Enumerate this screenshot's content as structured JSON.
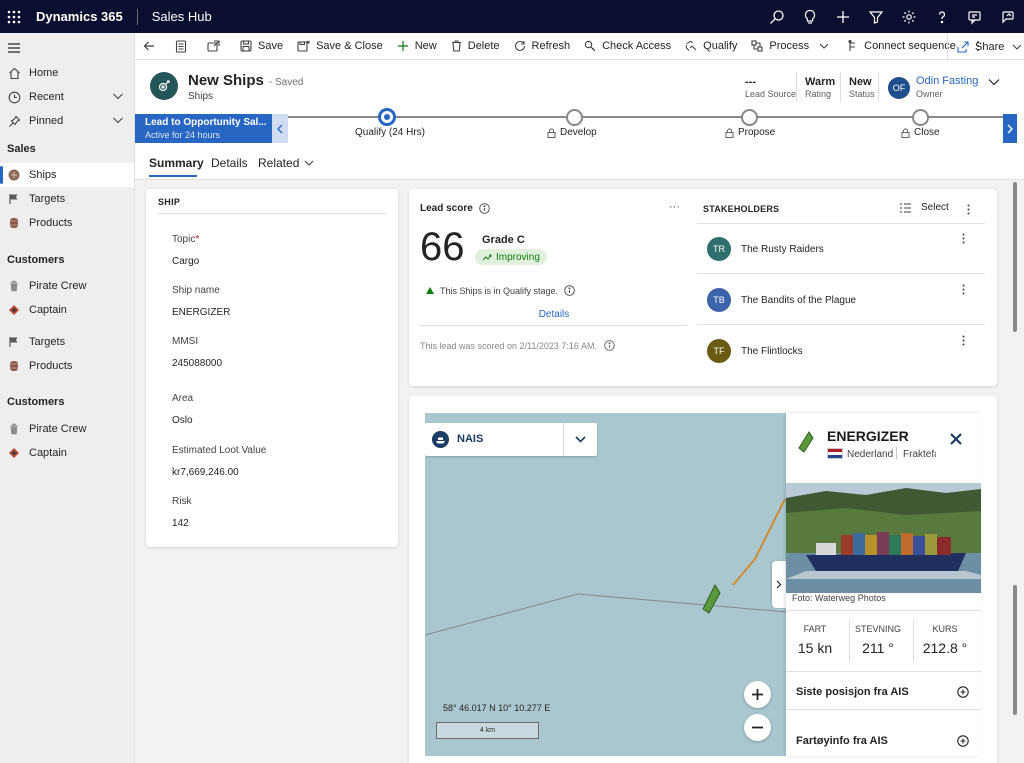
{
  "topbar": {
    "app_name": "Dynamics 365",
    "hub_name": "Sales Hub",
    "icons": [
      "search-icon",
      "lightbulb-icon",
      "plus-icon",
      "filter-icon",
      "settings-icon",
      "help-icon",
      "chat-icon",
      "assist-icon"
    ]
  },
  "sidebar": {
    "home": "Home",
    "recent": "Recent",
    "pinned": "Pinned",
    "section_sales": "Sales",
    "ships": "Ships",
    "targets": "Targets",
    "products": "Products",
    "section_customers": "Customers",
    "pirate_crew": "Pirate Crew",
    "captain": "Captain",
    "targets2": "Targets",
    "products2": "Products",
    "section_customers2": "Customers",
    "pirate_crew2": "Pirate Crew",
    "captain2": "Captain"
  },
  "cmdbar": {
    "save": "Save",
    "save_close": "Save & Close",
    "new": "New",
    "delete": "Delete",
    "refresh": "Refresh",
    "check_access": "Check Access",
    "qualify": "Qualify",
    "process": "Process",
    "connect_sequence": "Connect sequence",
    "share": "Share"
  },
  "header": {
    "title": "New Ships",
    "saved": "- Saved",
    "entity": "Ships",
    "lead_source_value": "---",
    "lead_source_label": "Lead Source",
    "rating_value": "Warm",
    "rating_label": "Rating",
    "status_value": "New",
    "status_label": "Status",
    "owner_initials": "OF",
    "owner_name": "Odin Fasting",
    "owner_label": "Owner"
  },
  "bpf": {
    "process_name": "Lead to Opportunity Sal...",
    "active_for": "Active for 24 hours",
    "stages": [
      {
        "label": "Qualify  (24 Hrs)"
      },
      {
        "label": "Develop"
      },
      {
        "label": "Propose"
      },
      {
        "label": "Close"
      }
    ]
  },
  "tabs": {
    "summary": "Summary",
    "details": "Details",
    "related": "Related"
  },
  "ship_card": {
    "section": "SHIP",
    "topic_label": "Topic",
    "topic_required": "*",
    "topic_value": "Cargo",
    "shipname_label": "Ship name",
    "shipname_value": "ENERGIZER",
    "mmsi_label": "MMSI",
    "mmsi_value": "245088000",
    "area_label": "Area",
    "area_value": "Oslo",
    "loot_label": "Estimated Loot Value",
    "loot_value": "kr7,669,246.00",
    "risk_label": "Risk",
    "risk_value": "142"
  },
  "lead_score": {
    "title": "Lead score",
    "score": "66",
    "grade": "Grade C",
    "trend": "Improving",
    "stage_text": "This Ships is in Qualify stage.",
    "details_link": "Details",
    "scored_text": "This lead was scored on 2/11/2023 7:16 AM.",
    "trend_color": "#107c10"
  },
  "stakeholders": {
    "title": "STAKEHOLDERS",
    "select": "Select",
    "items": [
      {
        "initials": "TR",
        "name": "The Rusty Raiders",
        "color": "#2f6f6f"
      },
      {
        "initials": "TB",
        "name": "The Bandits of the Plague",
        "color": "#3c62a8"
      },
      {
        "initials": "TF",
        "name": "The Flintlocks",
        "color": "#6b5a12"
      }
    ]
  },
  "map": {
    "layer_name": "NAIS",
    "coords": "58° 46.017 N 10° 10.277 E",
    "scale": "4 km"
  },
  "vessel": {
    "name": "ENERGIZER",
    "country": "Nederland",
    "type": "Fraktefa",
    "photo_credit": "Foto: Waterweg Photos",
    "fart_label": "FART",
    "fart_value": "15 kn",
    "stevning_label": "STEVNING",
    "stevning_value": "211 °",
    "kurs_label": "KURS",
    "kurs_value": "212.8 °",
    "ais_position": "Siste posisjon fra AIS",
    "ais_info": "Fartøyinfo fra AIS"
  }
}
